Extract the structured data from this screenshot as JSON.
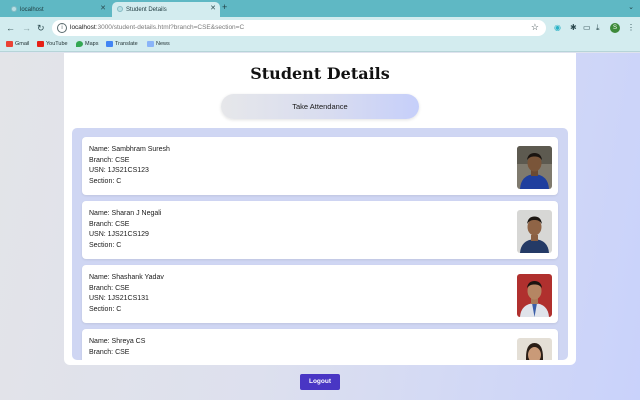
{
  "browser": {
    "tabs": [
      {
        "label": "localhost"
      },
      {
        "label": "Student Details"
      }
    ],
    "url_host": "localhost",
    "url_rest": ":3000/student-details.html?branch=CSE&section=C",
    "profile_initial": "S",
    "bookmarks": [
      {
        "label": "Gmail"
      },
      {
        "label": "YouTube"
      },
      {
        "label": "Maps"
      },
      {
        "label": "Translate"
      },
      {
        "label": "News"
      }
    ]
  },
  "page": {
    "title": "Student Details",
    "attendance_button": "Take Attendance",
    "logout_button": "Logout",
    "students": [
      {
        "name": "Name: Sambhram Suresh",
        "branch": "Branch: CSE",
        "usn": "USN: 1JS21CS123",
        "section": "Section: C"
      },
      {
        "name": "Name: Sharan J Negali",
        "branch": "Branch: CSE",
        "usn": "USN: 1JS21CS129",
        "section": "Section: C"
      },
      {
        "name": "Name: Shashank Yadav",
        "branch": "Branch: CSE",
        "usn": "USN: 1JS21CS131",
        "section": "Section: C"
      },
      {
        "name": "Name: Shreya CS",
        "branch": "Branch: CSE"
      }
    ]
  },
  "colors": {
    "tab_bar": "#5fb8c4",
    "toolbar": "#d3ecef",
    "logout_button": "#4936c4",
    "list_panel": "#cfd6f3"
  }
}
